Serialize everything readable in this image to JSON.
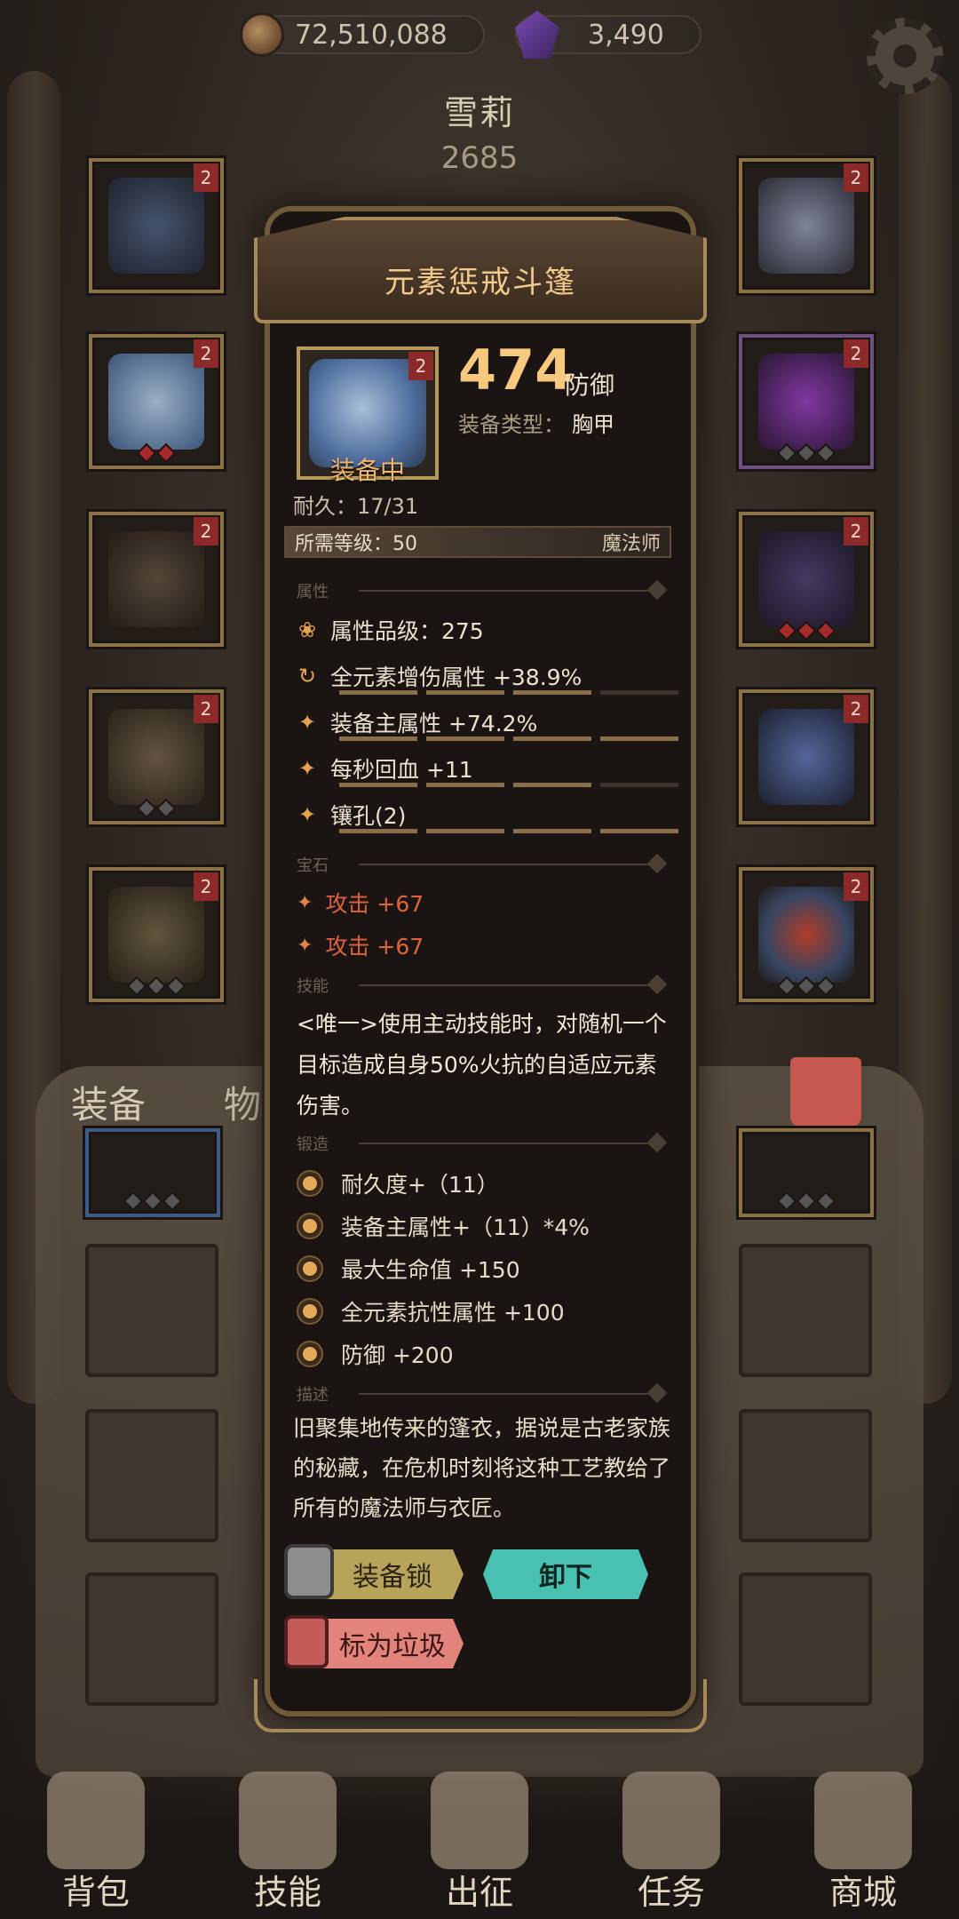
{
  "currency": {
    "coins": "72,510,088",
    "gems": "3,490",
    "icons": [
      "coin-icon",
      "gem-icon",
      "gear-icon"
    ]
  },
  "character": {
    "name": "雪莉",
    "power": "2685"
  },
  "slot_levels": [
    "2",
    "2",
    "2",
    "2",
    "2",
    "2",
    "2",
    "2",
    "2",
    "2"
  ],
  "tabs": {
    "equipment": "装备",
    "items": "物品"
  },
  "bottom_nav": [
    {
      "label": "背包",
      "icon": "backpack-icon"
    },
    {
      "label": "技能",
      "icon": "skill-icon"
    },
    {
      "label": "出征",
      "icon": "expedition-icon"
    },
    {
      "label": "任务",
      "icon": "quest-icon"
    },
    {
      "label": "商城",
      "icon": "shop-icon"
    }
  ],
  "item": {
    "name": "元素惩戒斗篷",
    "level_badge": "2",
    "equipped_label": "装备中",
    "stat_value": "474",
    "stat_unit": "防御",
    "type_label": "装备类型：",
    "type_value": "胸甲",
    "durability": "耐久：17/31",
    "required_level": "所需等级：50",
    "required_class": "魔法师",
    "sections": {
      "attributes": "属性",
      "gems": "宝石",
      "skill": "技能",
      "forge": "锻造",
      "description": "描述"
    },
    "attribute_grade": "属性品级：275",
    "attributes": [
      {
        "text": "全元素增伤属性 +38.9%"
      },
      {
        "text": "装备主属性 +74.2%"
      },
      {
        "text": "每秒回血 +11"
      },
      {
        "text": "镶孔(2)"
      }
    ],
    "gems": [
      "攻击 +67",
      "攻击 +67"
    ],
    "skill_text": "<唯一>使用主动技能时，对随机一个目标造成自身50%火抗的自适应元素伤害。",
    "forge": [
      "耐久度+（11）",
      "装备主属性+（11）*4%",
      "最大生命值 +150",
      "全元素抗性属性 +100",
      "防御 +200"
    ],
    "description": "旧聚集地传来的篷衣，据说是古老家族的秘藏，在危机时刻将这种工艺教给了所有的魔法师与衣匠。"
  },
  "buttons": {
    "lock": "装备锁",
    "unequip": "卸下",
    "mark_junk": "标为垃圾"
  },
  "colors": {
    "accent_gold": "#f7c97c",
    "gem_red": "#e0613d",
    "unequip_teal": "#48c1b3",
    "lock_yellow": "#b8a35a",
    "junk_red": "#e2847c"
  }
}
